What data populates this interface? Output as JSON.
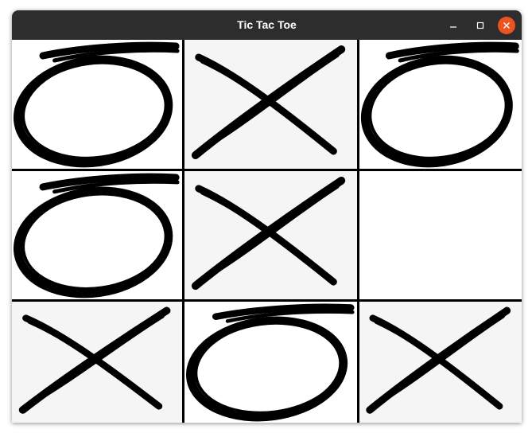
{
  "window": {
    "title": "Tic Tac Toe",
    "controls": [
      "minimize-icon",
      "maximize-icon",
      "close-icon"
    ],
    "close_color": "#e95420"
  },
  "board": {
    "rows": [
      [
        "O",
        "X",
        "O"
      ],
      [
        "O",
        "X",
        ""
      ],
      [
        "X",
        "O",
        "X"
      ]
    ],
    "cell_backgrounds": {
      "X": "#f5f5f5",
      "O": "#ffffff",
      "empty": "#ffffff"
    }
  }
}
